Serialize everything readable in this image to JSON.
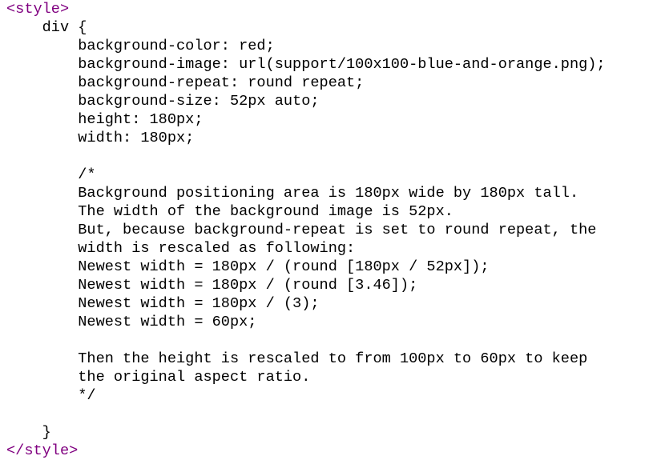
{
  "code": {
    "open_tag": "<style>",
    "selector_line": "    div {",
    "declarations": [
      "        background-color: red;",
      "        background-image: url(support/100x100-blue-and-orange.png);",
      "        background-repeat: round repeat;",
      "        background-size: 52px auto;",
      "        height: 180px;",
      "        width: 180px;"
    ],
    "comment": [
      "        /*",
      "        Background positioning area is 180px wide by 180px tall.",
      "        The width of the background image is 52px.",
      "        But, because background-repeat is set to round repeat, the",
      "        width is rescaled as following:",
      "        Newest width = 180px / (round [180px / 52px]);",
      "        Newest width = 180px / (round [3.46]);",
      "        Newest width = 180px / (3);",
      "        Newest width = 60px;",
      "",
      "        Then the height is rescaled to from 100px to 60px to keep",
      "        the original aspect ratio.",
      "        */"
    ],
    "closing_brace": "    }",
    "close_tag": "</style>"
  }
}
